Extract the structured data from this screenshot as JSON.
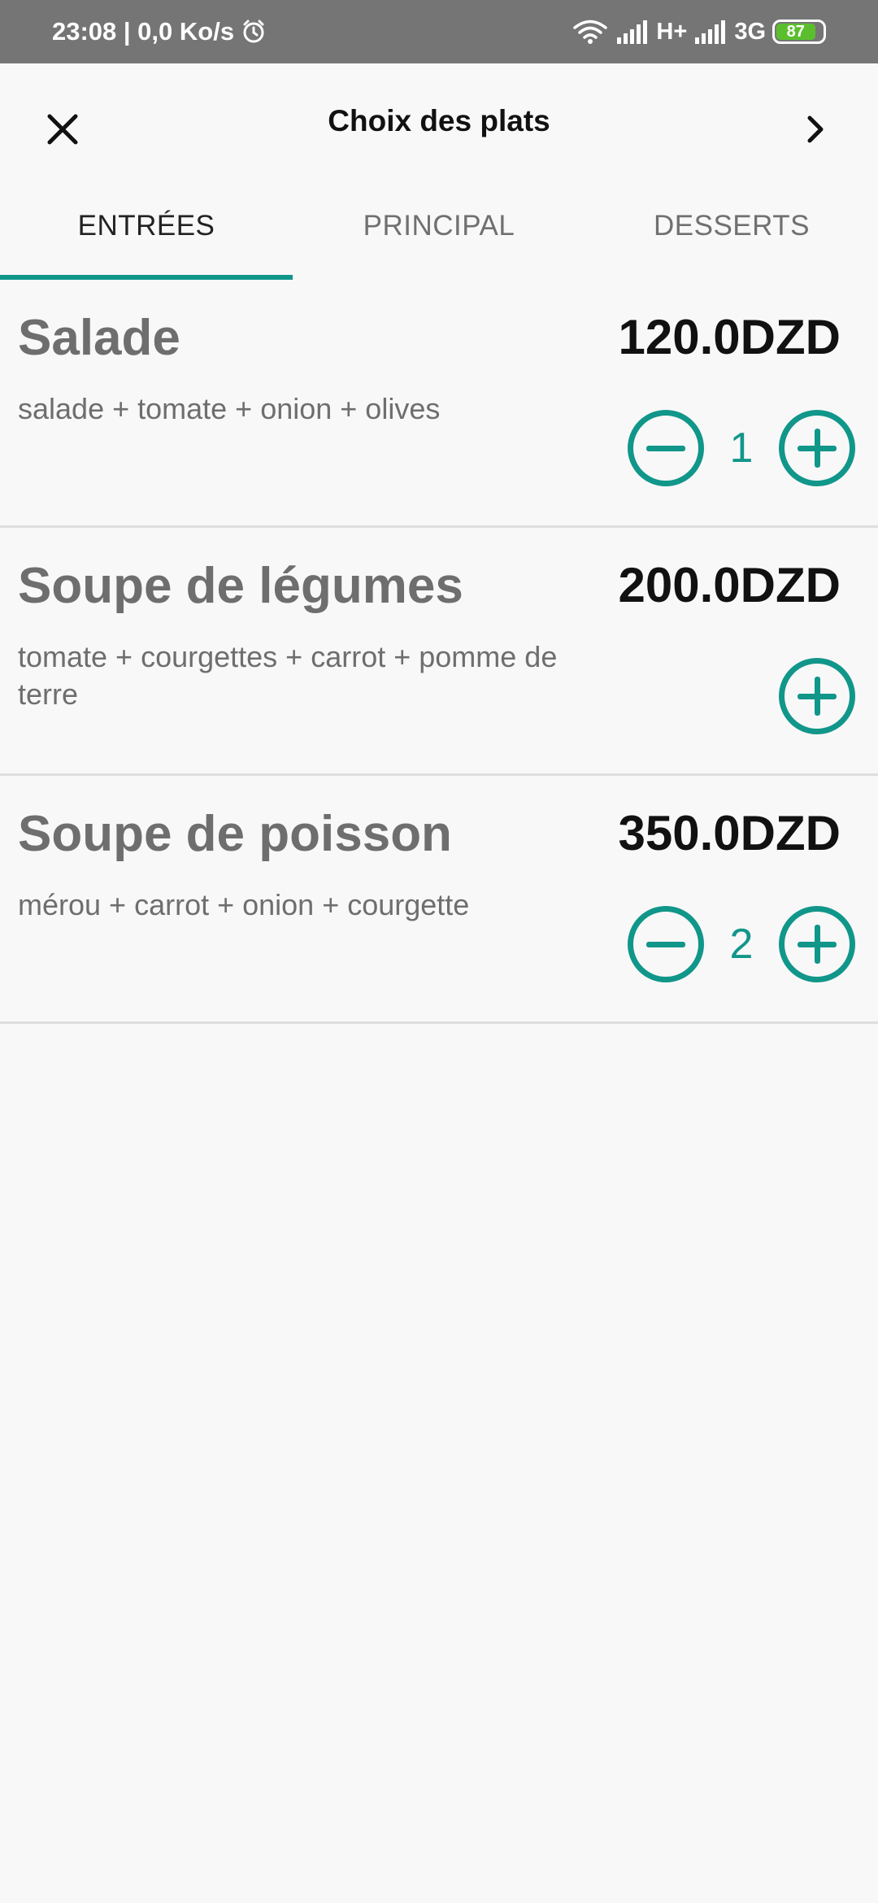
{
  "status_bar": {
    "time_and_speed": "23:08 | 0,0 Ko/s",
    "network_1": "H+",
    "network_2": "3G",
    "battery": "87",
    "icons": [
      "alarm-icon",
      "wifi-icon",
      "signal-icon",
      "signal-icon",
      "battery-icon"
    ]
  },
  "app_bar": {
    "title": "Choix des plats",
    "left_icon": "close-icon",
    "right_icon": "chevron-right-icon"
  },
  "tabs": [
    {
      "label": "ENTRÉES",
      "active": true
    },
    {
      "label": "PRINCIPAL",
      "active": false
    },
    {
      "label": "DESSERTS",
      "active": false
    }
  ],
  "items": [
    {
      "name": "Salade",
      "price": "120.0DZD",
      "description": "salade + tomate + onion + olives",
      "quantity": "1"
    },
    {
      "name": "Soupe de légumes",
      "price": "200.0DZD",
      "description": "tomate + courgettes + carrot + pomme de terre",
      "quantity": ""
    },
    {
      "name": "Soupe de poisson",
      "price": "350.0DZD",
      "description": "mérou + carrot + onion + courgette",
      "quantity": "2"
    }
  ],
  "colors": {
    "accent": "#11968a",
    "status_bar": "#757575",
    "battery": "#5bbf2d"
  }
}
